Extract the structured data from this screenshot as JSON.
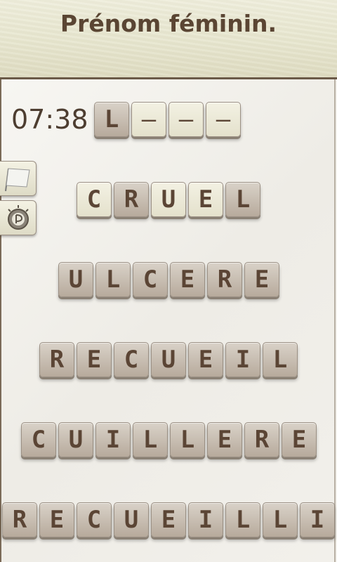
{
  "header": {
    "title": "Prénom féminin."
  },
  "game": {
    "timer": "07:38",
    "answer_tiles": [
      "L",
      "_",
      "_",
      "_"
    ],
    "words": [
      {
        "word": "CRUEL",
        "styles": [
          "light",
          "dark",
          "light",
          "light",
          "dark"
        ]
      },
      {
        "word": "ULCERE",
        "styles": [
          "dark",
          "dark",
          "dark",
          "dark",
          "dark",
          "dark"
        ]
      },
      {
        "word": "RECUEIL",
        "styles": [
          "dark",
          "dark",
          "dark",
          "dark",
          "dark",
          "dark",
          "dark"
        ]
      },
      {
        "word": "CUILLERE",
        "styles": [
          "dark",
          "dark",
          "dark",
          "dark",
          "dark",
          "dark",
          "dark",
          "dark"
        ]
      },
      {
        "word": "RECUEILLI",
        "styles": [
          "dark",
          "dark",
          "dark",
          "dark",
          "dark",
          "dark",
          "dark",
          "dark",
          "dark"
        ]
      }
    ]
  },
  "sidebar": {
    "icons": [
      "flag-icon",
      "hint-bulb-icon"
    ]
  },
  "colors": {
    "text_brown": "#5b4535",
    "header_bg": "#e7e6cf",
    "board_bg": "#f3f1ec"
  }
}
